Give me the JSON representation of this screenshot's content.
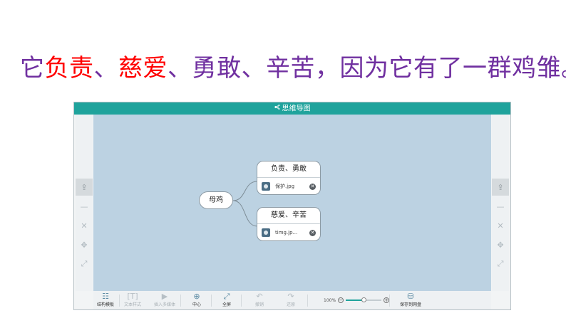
{
  "headline": {
    "segments": [
      {
        "text": "它",
        "color": "#7030a0"
      },
      {
        "text": "负责",
        "color": "#ff0000"
      },
      {
        "text": "、",
        "color": "#7030a0"
      },
      {
        "text": "慈爱",
        "color": "#ff0000"
      },
      {
        "text": "、勇敢、辛苦，因为它有了一群鸡雏。",
        "color": "#7030a0"
      }
    ]
  },
  "app": {
    "title": "思维导图",
    "accent_color": "#1fa39c",
    "side_buttons": [
      {
        "name": "share-icon",
        "glyph": "⇪"
      },
      {
        "name": "minus-icon",
        "glyph": "—"
      },
      {
        "name": "close-icon",
        "glyph": "✕"
      },
      {
        "name": "move-icon",
        "glyph": "✥"
      },
      {
        "name": "fullscreen-icon",
        "glyph": "⤢"
      }
    ],
    "mindmap": {
      "root": "母鸡",
      "children": [
        {
          "label": "负责、勇敢",
          "attachment": "保护.jpg"
        },
        {
          "label": "慈爱、辛苦",
          "attachment": "timg.jp..."
        }
      ]
    },
    "toolbar": {
      "structure_template": "结构模板",
      "text_style": "文本样式",
      "insert_media": "插入多媒体",
      "center": "中心",
      "fullscreen": "全屏",
      "undo": "撤销",
      "redo": "还原",
      "zoom_level": "100%",
      "zoom_fraction": 0.5,
      "save": "保存到网盘"
    }
  }
}
